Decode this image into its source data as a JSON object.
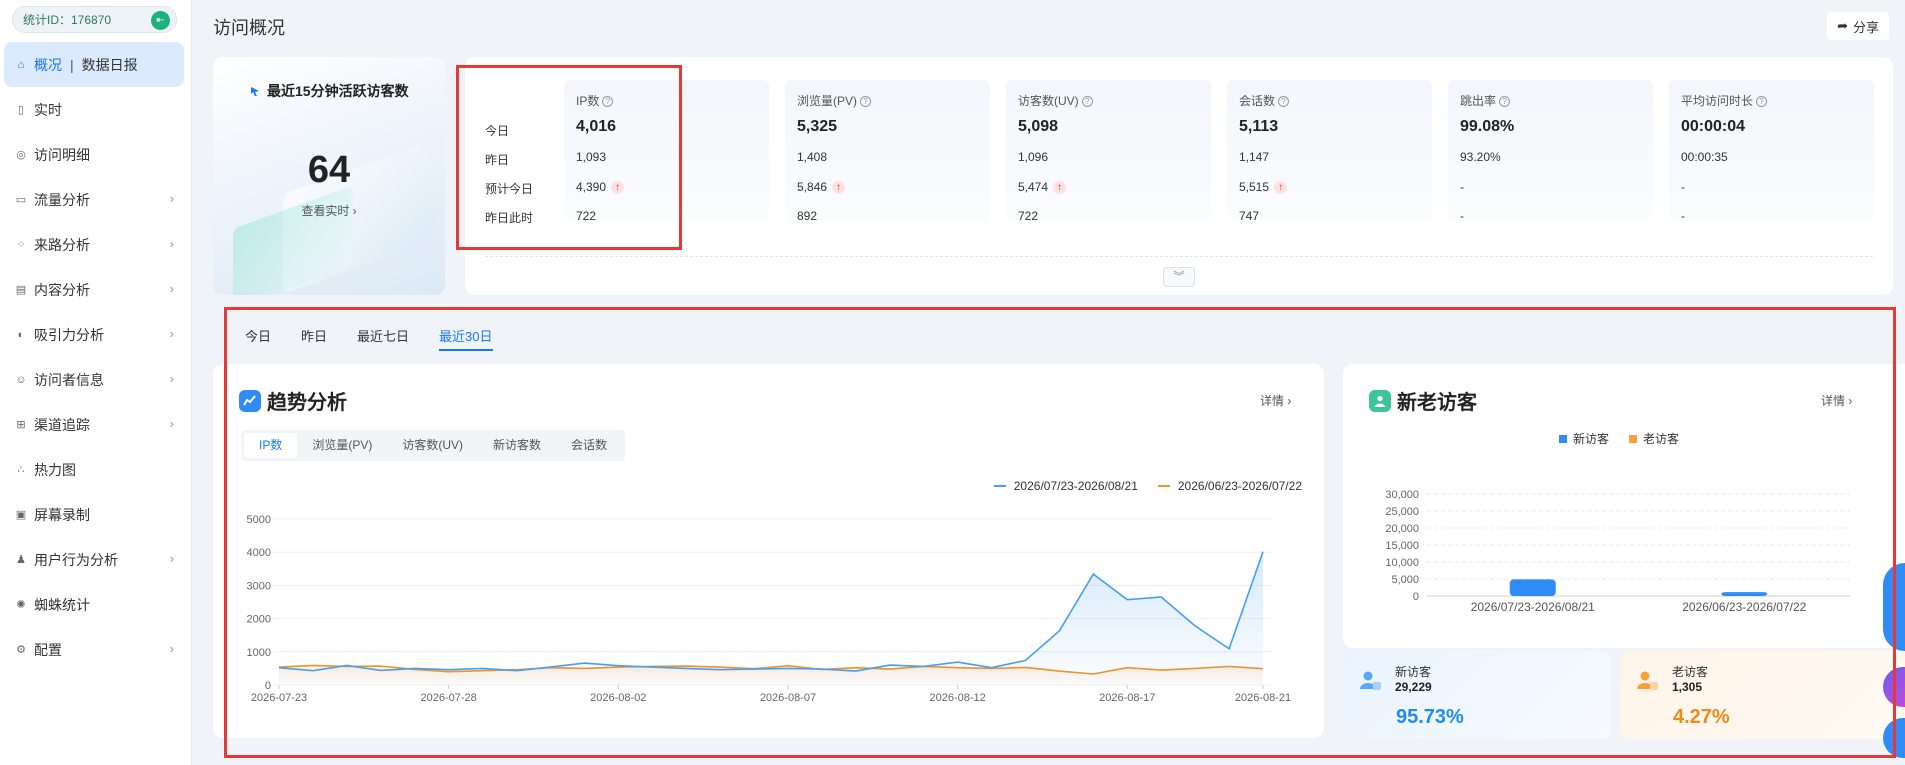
{
  "sidebar": {
    "stat_id": "统计ID：176870",
    "items": [
      {
        "label": "概况",
        "sub": "数据日报",
        "icon": "home-icon",
        "active": true,
        "chevron": false
      },
      {
        "label": "实时",
        "icon": "realtime-icon",
        "chevron": false
      },
      {
        "label": "访问明细",
        "icon": "detail-icon",
        "chevron": false
      },
      {
        "label": "流量分析",
        "icon": "traffic-icon",
        "chevron": true
      },
      {
        "label": "来路分析",
        "icon": "source-icon",
        "chevron": true
      },
      {
        "label": "内容分析",
        "icon": "content-icon",
        "chevron": true
      },
      {
        "label": "吸引力分析",
        "icon": "attract-icon",
        "chevron": true
      },
      {
        "label": "访问者信息",
        "icon": "visitor-icon",
        "chevron": true
      },
      {
        "label": "渠道追踪",
        "icon": "channel-icon",
        "chevron": true
      },
      {
        "label": "热力图",
        "icon": "heatmap-icon",
        "chevron": false
      },
      {
        "label": "屏幕录制",
        "icon": "record-icon",
        "chevron": false
      },
      {
        "label": "用户行为分析",
        "icon": "behavior-icon",
        "chevron": true
      },
      {
        "label": "蜘蛛统计",
        "icon": "spider-icon",
        "chevron": false
      },
      {
        "label": "配置",
        "icon": "config-icon",
        "chevron": true
      }
    ]
  },
  "header": {
    "title": "访问概况",
    "share_label": "分享"
  },
  "active_visitors": {
    "title": "最近15分钟活跃访客数",
    "value": "64",
    "link": "查看实时 ›"
  },
  "metrics": {
    "row_labels": [
      "今日",
      "昨日",
      "预计今日",
      "昨日此时"
    ],
    "columns": [
      {
        "name": "IP数",
        "today": "4,016",
        "yesterday": "1,093",
        "forecast": "4,390",
        "forecast_up": true,
        "yesterday_now": "722"
      },
      {
        "name": "浏览量(PV)",
        "today": "5,325",
        "yesterday": "1,408",
        "forecast": "5,846",
        "forecast_up": true,
        "yesterday_now": "892"
      },
      {
        "name": "访客数(UV)",
        "today": "5,098",
        "yesterday": "1,096",
        "forecast": "5,474",
        "forecast_up": true,
        "yesterday_now": "722"
      },
      {
        "name": "会话数",
        "today": "5,113",
        "yesterday": "1,147",
        "forecast": "5,515",
        "forecast_up": true,
        "yesterday_now": "747"
      },
      {
        "name": "跳出率",
        "today": "99.08%",
        "yesterday": "93.20%",
        "forecast": "-",
        "forecast_up": false,
        "yesterday_now": "-"
      },
      {
        "name": "平均访问时长",
        "today": "00:00:04",
        "yesterday": "00:00:35",
        "forecast": "-",
        "forecast_up": false,
        "yesterday_now": "-"
      }
    ]
  },
  "date_tabs": {
    "items": [
      "今日",
      "昨日",
      "最近七日",
      "最近30日"
    ],
    "active": 3
  },
  "trend": {
    "title": "趋势分析",
    "detail": "详情 ›",
    "tabs": [
      "IP数",
      "浏览量(PV)",
      "访客数(UV)",
      "新访客数",
      "会话数"
    ],
    "active_tab": 0
  },
  "new_old": {
    "title": "新老访客",
    "detail": "详情 ›",
    "new": {
      "label": "新访客",
      "value": "29,229",
      "percent": "95.73%"
    },
    "old": {
      "label": "老访客",
      "value": "1,305",
      "percent": "4.27%"
    }
  },
  "chart_data": [
    {
      "type": "line",
      "ylim": [
        0,
        5000
      ],
      "yticks": [
        0,
        1000,
        2000,
        3000,
        4000,
        5000
      ],
      "x": [
        "2026-07-23",
        "2026-07-24",
        "2026-07-25",
        "2026-07-26",
        "2026-07-27",
        "2026-07-28",
        "2026-07-29",
        "2026-07-30",
        "2026-07-31",
        "2026-08-01",
        "2026-08-02",
        "2026-08-03",
        "2026-08-04",
        "2026-08-05",
        "2026-08-06",
        "2026-08-07",
        "2026-08-08",
        "2026-08-09",
        "2026-08-10",
        "2026-08-11",
        "2026-08-12",
        "2026-08-13",
        "2026-08-14",
        "2026-08-15",
        "2026-08-16",
        "2026-08-17",
        "2026-08-18",
        "2026-08-19",
        "2026-08-20",
        "2026-08-21"
      ],
      "xtick_labels": [
        "2026-07-23",
        "2026-07-28",
        "2026-08-02",
        "2026-08-07",
        "2026-08-12",
        "2026-08-17",
        "2026-08-21"
      ],
      "legend_position": "top-right",
      "series": [
        {
          "name": "2026/07/23-2026/08/21",
          "color": "#4a9eef",
          "values": [
            520,
            430,
            590,
            440,
            500,
            460,
            500,
            430,
            540,
            660,
            580,
            540,
            500,
            460,
            480,
            500,
            480,
            420,
            600,
            560,
            690,
            520,
            740,
            1630,
            3340,
            2570,
            2650,
            1780,
            1090,
            4016
          ]
        },
        {
          "name": "2026/06/23-2026/07/22",
          "color": "#f0932b",
          "values": [
            540,
            590,
            560,
            570,
            470,
            400,
            430,
            460,
            520,
            500,
            540,
            560,
            570,
            540,
            490,
            580,
            470,
            520,
            480,
            560,
            520,
            500,
            530,
            420,
            330,
            520,
            450,
            500,
            560,
            490
          ]
        }
      ]
    },
    {
      "type": "bar",
      "categories": [
        "2026/07/23-2026/08/21",
        "2026/06/23-2026/07/22"
      ],
      "ylim": [
        0,
        30000
      ],
      "yticks": [
        0,
        5000,
        10000,
        15000,
        20000,
        25000,
        30000
      ],
      "ytick_labels": [
        "0",
        "5,000",
        "10,000",
        "15,000",
        "20,000",
        "25,000",
        "30,000"
      ],
      "legend_position": "top-center",
      "series": [
        {
          "name": "新访客",
          "color": "#2f8cf7",
          "values": [
            4900,
            1150
          ]
        },
        {
          "name": "老访客",
          "color": "#f7a03a",
          "values": [
            0,
            0
          ]
        }
      ]
    }
  ]
}
